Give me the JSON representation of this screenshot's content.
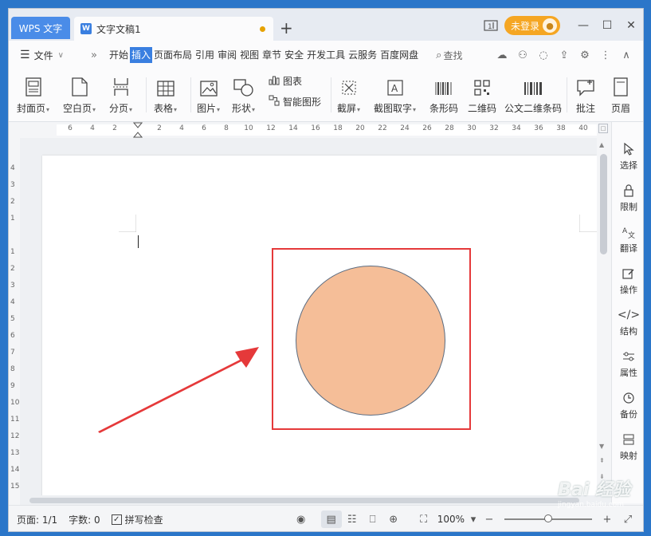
{
  "titlebar": {
    "app_tab": "WPS 文字",
    "doc_tab": "文字文稿1",
    "new_tab": "+",
    "login": "未登录"
  },
  "menubar": {
    "file": "文件",
    "items": [
      "开始",
      "插入",
      "页面布局",
      "引用",
      "审阅",
      "视图",
      "章节",
      "安全",
      "开发工具",
      "云服务",
      "百度网盘"
    ],
    "active": "插入",
    "search": "查找"
  },
  "ribbon": {
    "cover": "封面页",
    "blank": "空白页",
    "break": "分页",
    "table": "表格",
    "picture": "图片",
    "shape": "形状",
    "chart": "图表",
    "smart": "智能图形",
    "screenshot": "截屏",
    "ocr": "截图取字",
    "barcode": "条形码",
    "qrcode": "二维码",
    "doc_qrcode": "公文二维条码",
    "comment": "批注",
    "header": "页眉"
  },
  "hruler": [
    "6",
    "4",
    "2",
    "2",
    "4",
    "6",
    "8",
    "10",
    "12",
    "14",
    "16",
    "18",
    "20",
    "22",
    "24",
    "26",
    "28",
    "30",
    "32",
    "34",
    "36",
    "38",
    "40"
  ],
  "vruler": [
    "4",
    "3",
    "2",
    "1",
    "1",
    "1",
    "2",
    "3",
    "4",
    "5",
    "6",
    "7",
    "8",
    "9",
    "10",
    "11",
    "12",
    "13",
    "14",
    "15"
  ],
  "sidepanel": {
    "select": "选择",
    "limit": "限制",
    "translate": "翻译",
    "action": "操作",
    "structure": "结构",
    "property": "属性",
    "backup": "备份",
    "map": "映射"
  },
  "status": {
    "page": "页面: 1/1",
    "words": "字数: 0",
    "spell": "拼写检查",
    "zoom": "100%",
    "minus": "−",
    "plus": "+"
  },
  "watermark": "Bai 经验",
  "watermark_sub": "jingyan.baidu.com",
  "colors": {
    "frame": "#e5393a",
    "circle_fill": "#f5be98",
    "active_menu": "#3a7fe0",
    "login": "#f5a623"
  }
}
